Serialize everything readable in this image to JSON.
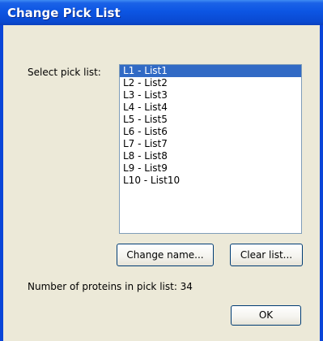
{
  "window": {
    "title": "Change Pick List"
  },
  "picklist": {
    "label": "Select pick list:",
    "items": [
      "L1 - List1",
      "L2 - List2",
      "L3 - List3",
      "L4 - List4",
      "L5 - List5",
      "L6 - List6",
      "L7 - List7",
      "L8 - List8",
      "L9 - List9",
      "L10 - List10"
    ],
    "selected": "L1 - List1"
  },
  "buttons": {
    "change_name": "Change name...",
    "clear_list": "Clear list...",
    "ok": "OK"
  },
  "status": {
    "proteins_text": "Number of proteins in pick list:  34"
  },
  "colors": {
    "title_bar": "#0a4ad2",
    "selection": "#316ac5",
    "dialog_bg": "#ece9d8"
  }
}
